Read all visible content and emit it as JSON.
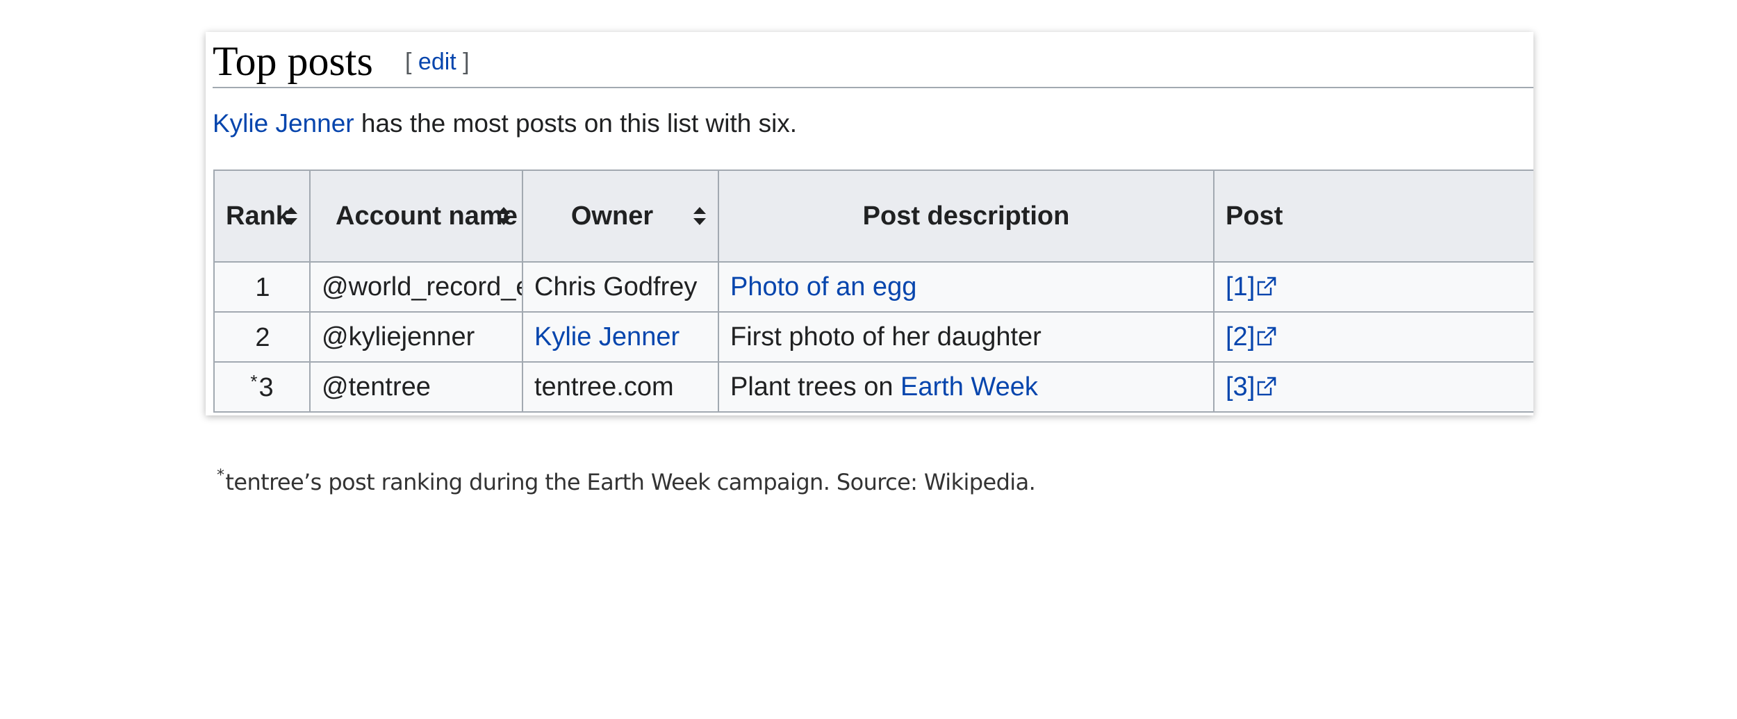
{
  "section": {
    "title": "Top posts",
    "edit_open": "[ ",
    "edit_label": "edit",
    "edit_close": " ]"
  },
  "intro": {
    "link_text": "Kylie Jenner",
    "rest_text": " has the most posts on this list with six."
  },
  "table": {
    "headers": {
      "rank": "Rank",
      "account": "Account name",
      "owner": "Owner",
      "description": "Post description",
      "post": "Post"
    },
    "rows": [
      {
        "rank_marker": "",
        "rank": "1",
        "account": "@world_record_egg",
        "owner": "Chris Godfrey",
        "description_prefix": "",
        "description_link": "Photo of an egg",
        "post_ref": "[1]"
      },
      {
        "rank_marker": "",
        "rank": "2",
        "account": "@kyliejenner",
        "owner": "Kylie Jenner",
        "description": "First photo of her daughter",
        "post_ref": "[2]"
      },
      {
        "rank_marker": "*",
        "rank": "3",
        "account": "@tentree",
        "owner": "tentree.com",
        "description_prefix": "Plant trees on ",
        "description_link": "Earth Week",
        "post_ref": "[3]"
      }
    ]
  },
  "footnote": {
    "marker": "*",
    "text": "tentree’s post ranking during the Earth Week campaign. Source: Wikipedia."
  },
  "colors": {
    "link": "#0645ad",
    "header_bg": "#eaecf0",
    "cell_bg": "#f8f9fa",
    "border": "#a2a9b1"
  },
  "icons": {
    "sort": "sort-icon",
    "external_link": "external-link-icon"
  }
}
